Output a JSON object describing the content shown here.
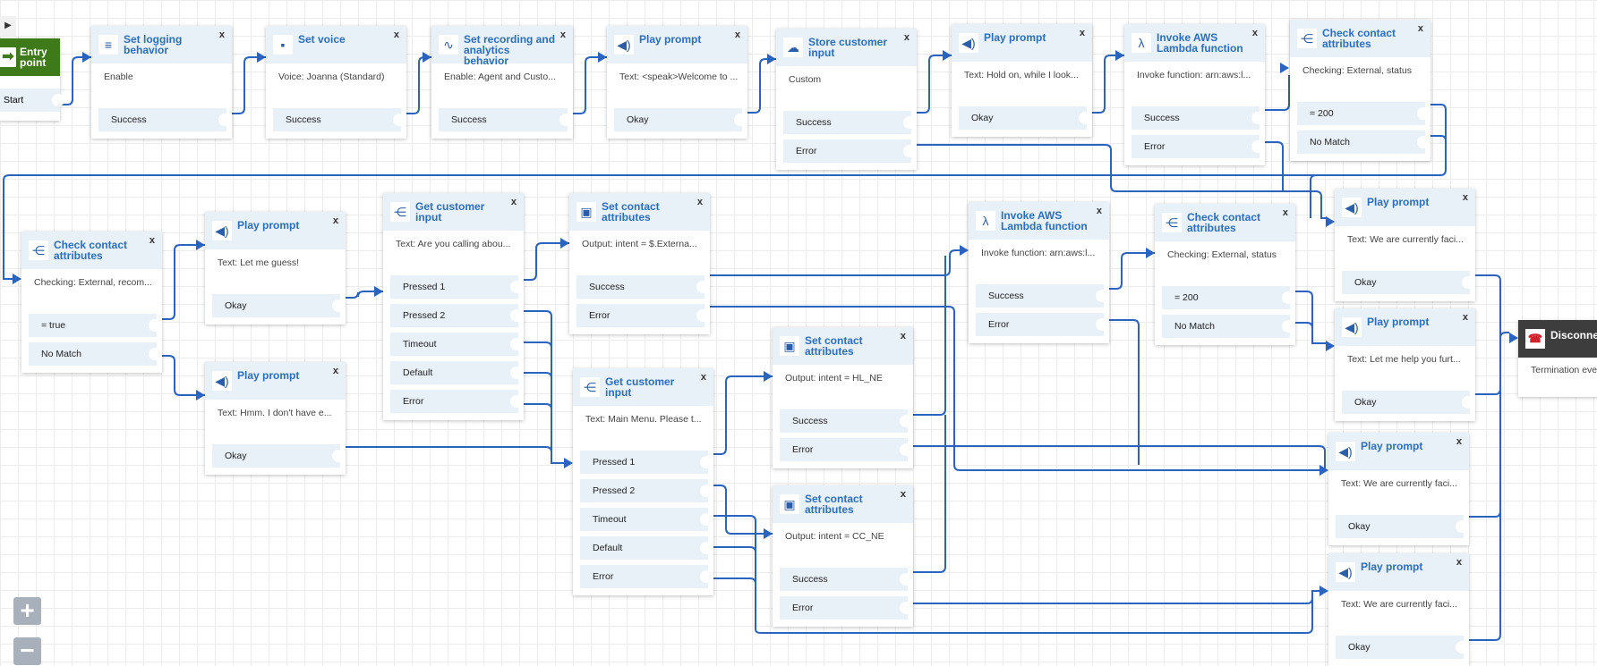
{
  "canvas": {
    "toggle_icon": "▶",
    "zoom_in_label": "+",
    "zoom_out_label": "−",
    "wire_color": "#2a64c0"
  },
  "entry": {
    "title_line1": "Entry",
    "title_line2": "point",
    "branch": "Start",
    "icon": "arrow-right-icon"
  },
  "disconnect": {
    "title": "Disconnect",
    "desc": "Termination event",
    "icon": "hang-up-icon"
  },
  "nodes": [
    {
      "id": "set-logging",
      "title": "Set logging behavior",
      "desc": "Enable",
      "icon": "logging-icon",
      "glyph": "≡",
      "branches": [
        "Success"
      ]
    },
    {
      "id": "set-voice",
      "title": "Set voice",
      "desc": "Voice: Joanna (Standard)",
      "icon": "voice-icon",
      "glyph": "▪",
      "branches": [
        "Success"
      ]
    },
    {
      "id": "set-recording",
      "title": "Set recording and analytics behavior",
      "desc": "Enable: Agent and Custo...",
      "icon": "waveform-icon",
      "glyph": "∿",
      "branches": [
        "Success"
      ]
    },
    {
      "id": "play-welcome",
      "title": "Play prompt",
      "desc": "Text: <speak>Welcome to ...",
      "icon": "speaker-icon",
      "glyph": "◀)",
      "branches": [
        "Okay"
      ]
    },
    {
      "id": "store-input",
      "title": "Store customer input",
      "desc": "Custom",
      "icon": "cloud-icon",
      "glyph": "☁",
      "branches": [
        "Success",
        "Error"
      ]
    },
    {
      "id": "play-hold",
      "title": "Play prompt",
      "desc": "Text: Hold on, while I look...",
      "icon": "speaker-icon",
      "glyph": "◀)",
      "branches": [
        "Okay"
      ]
    },
    {
      "id": "lambda-1",
      "title": "Invoke AWS Lambda function",
      "desc": "Invoke function: arn:aws:l...",
      "icon": "lambda-icon",
      "glyph": "λ",
      "branches": [
        "Success",
        "Error"
      ]
    },
    {
      "id": "check-1",
      "title": "Check contact attributes",
      "desc": "Checking: External, status",
      "icon": "branch-icon",
      "glyph": "⋲",
      "branches": [
        "= 200",
        "No Match"
      ]
    },
    {
      "id": "check-2",
      "title": "Check contact attributes",
      "desc": "Checking: External, recom...",
      "icon": "branch-icon",
      "glyph": "⋲",
      "branches": [
        "= true",
        "No Match"
      ]
    },
    {
      "id": "play-guess",
      "title": "Play prompt",
      "desc": "Text: Let me guess!",
      "icon": "speaker-icon",
      "glyph": "◀)",
      "branches": [
        "Okay"
      ]
    },
    {
      "id": "play-hmm",
      "title": "Play prompt",
      "desc": "Text: Hmm. I don't have e...",
      "icon": "speaker-icon",
      "glyph": "◀)",
      "branches": [
        "Okay"
      ]
    },
    {
      "id": "get-input-1",
      "title": "Get customer input",
      "desc": "Text: Are you calling abou...",
      "icon": "customer-input-icon",
      "glyph": "⋲",
      "branches": [
        "Pressed 1",
        "Pressed 2",
        "Timeout",
        "Default",
        "Error"
      ]
    },
    {
      "id": "set-attr-1",
      "title": "Set contact attributes",
      "desc": "Output: intent = $.Externa...",
      "icon": "contact-attributes-icon",
      "glyph": "▣",
      "branches": [
        "Success",
        "Error"
      ]
    },
    {
      "id": "get-input-2",
      "title": "Get customer input",
      "desc": "Text: Main Menu. Please t...",
      "icon": "customer-input-icon",
      "glyph": "⋲",
      "branches": [
        "Pressed 1",
        "Pressed 2",
        "Timeout",
        "Default",
        "Error"
      ]
    },
    {
      "id": "set-attr-hl",
      "title": "Set contact attributes",
      "desc": "Output: intent = HL_NE",
      "icon": "contact-attributes-icon",
      "glyph": "▣",
      "branches": [
        "Success",
        "Error"
      ]
    },
    {
      "id": "set-attr-cc",
      "title": "Set contact attributes",
      "desc": "Output: intent = CC_NE",
      "icon": "contact-attributes-icon",
      "glyph": "▣",
      "branches": [
        "Success",
        "Error"
      ]
    },
    {
      "id": "lambda-2",
      "title": "Invoke AWS Lambda function",
      "desc": "Invoke function: arn:aws:l...",
      "icon": "lambda-icon",
      "glyph": "λ",
      "branches": [
        "Success",
        "Error"
      ]
    },
    {
      "id": "check-3",
      "title": "Check contact attributes",
      "desc": "Checking: External, status",
      "icon": "branch-icon",
      "glyph": "⋲",
      "branches": [
        "= 200",
        "No Match"
      ]
    },
    {
      "id": "play-faci-1",
      "title": "Play prompt",
      "desc": "Text: We are currently faci...",
      "icon": "speaker-icon",
      "glyph": "◀)",
      "branches": [
        "Okay"
      ]
    },
    {
      "id": "play-help",
      "title": "Play prompt",
      "desc": "Text: Let me help you furt...",
      "icon": "speaker-icon",
      "glyph": "◀)",
      "branches": [
        "Okay"
      ]
    },
    {
      "id": "play-faci-2",
      "title": "Play prompt",
      "desc": "Text: We are currently faci...",
      "icon": "speaker-icon",
      "glyph": "◀)",
      "branches": [
        "Okay"
      ]
    },
    {
      "id": "play-faci-3",
      "title": "Play prompt",
      "desc": "Text: We are currently faci...",
      "icon": "speaker-icon",
      "glyph": "◀)",
      "branches": [
        "Okay"
      ]
    }
  ]
}
